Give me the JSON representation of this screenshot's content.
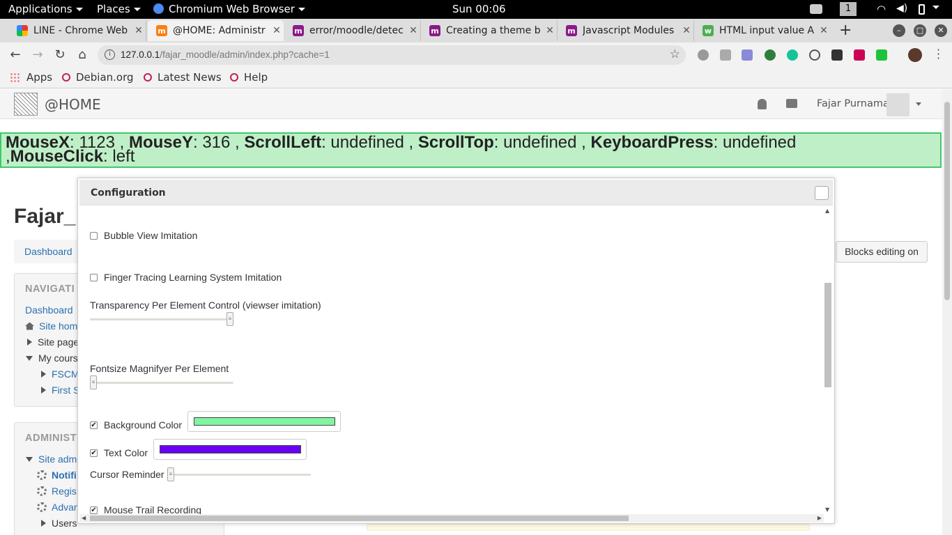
{
  "system_bar": {
    "applications": "Applications",
    "places": "Places",
    "browser": "Chromium Web Browser",
    "clock": "Sun 00:06",
    "workspace": "1"
  },
  "tabs": [
    {
      "title": "LINE - Chrome Web",
      "icon": "line-icon",
      "color": "#1fc33b",
      "active": false
    },
    {
      "title": "@HOME: Administr",
      "icon": "moodle-icon",
      "color": "#f98012",
      "active": true
    },
    {
      "title": "error/moodle/detec",
      "icon": "moodle-docs-icon",
      "color": "#8b1a89",
      "active": false
    },
    {
      "title": "Creating a theme b",
      "icon": "moodle-docs-icon",
      "color": "#8b1a89",
      "active": false
    },
    {
      "title": "Javascript Modules",
      "icon": "moodle-docs-icon",
      "color": "#8b1a89",
      "active": false
    },
    {
      "title": "HTML input value A",
      "icon": "w3schools-icon",
      "color": "#4caf50",
      "active": false
    }
  ],
  "address_bar": {
    "host": "127.0.0.1",
    "path": "/fajar_moodle/admin/index.php?cache=1"
  },
  "bookmarks": [
    "Apps",
    "Debian.org",
    "Latest News",
    "Help"
  ],
  "moodle": {
    "site_name": "@HOME",
    "user_name": "Fajar Purnama",
    "page_title": "Fajar_",
    "breadcrumb": "Dashboard",
    "blocks_button": "Blocks editing on",
    "navigation": {
      "heading": "NAVIGATI",
      "items": [
        "Dashboard",
        "Site hom",
        "Site page",
        "My cours",
        "FSCM",
        "First S"
      ]
    },
    "administration": {
      "heading": "ADMINIST",
      "items": [
        "Site adm",
        "Notifi",
        "Regis",
        "Advan",
        "Users"
      ]
    }
  },
  "status": {
    "mousex_label": "MouseX",
    "mousex_value": ": 1123 ,",
    "mousey_label": "MouseY",
    "mousey_value": ": 316 ,",
    "scrollleft_label": "ScrollLeft",
    "scrollleft_value": ": undefined ,",
    "scrolltop_label": "ScrollTop",
    "scrolltop_value": ": undefined ,",
    "keyboard_label": "KeyboardPress",
    "keyboard_value": ": undefined",
    "click_prefix": ",",
    "click_label": "MouseClick",
    "click_value": ": left"
  },
  "config": {
    "title": "Configuration",
    "bubble_view": {
      "label": "Bubble View Imitation",
      "checked": false
    },
    "finger_tracing": {
      "label": "Finger Tracing Learning System Imitation",
      "checked": false
    },
    "transparency": {
      "label": "Transparency Per Element Control (viewser imitation)",
      "level": 1.0
    },
    "fontsize": {
      "label": "Fontsize Magnifyer Per Element",
      "level": 0.0
    },
    "background_color": {
      "label": "Background Color",
      "checked": true,
      "color": "#80f5a2"
    },
    "text_color": {
      "label": "Text Color",
      "checked": true,
      "color": "#6a00f4"
    },
    "cursor_reminder": {
      "label": "Cursor Reminder",
      "level": 0.0
    },
    "mouse_trail": {
      "label": "Mouse Trail Recording",
      "checked": true
    }
  }
}
